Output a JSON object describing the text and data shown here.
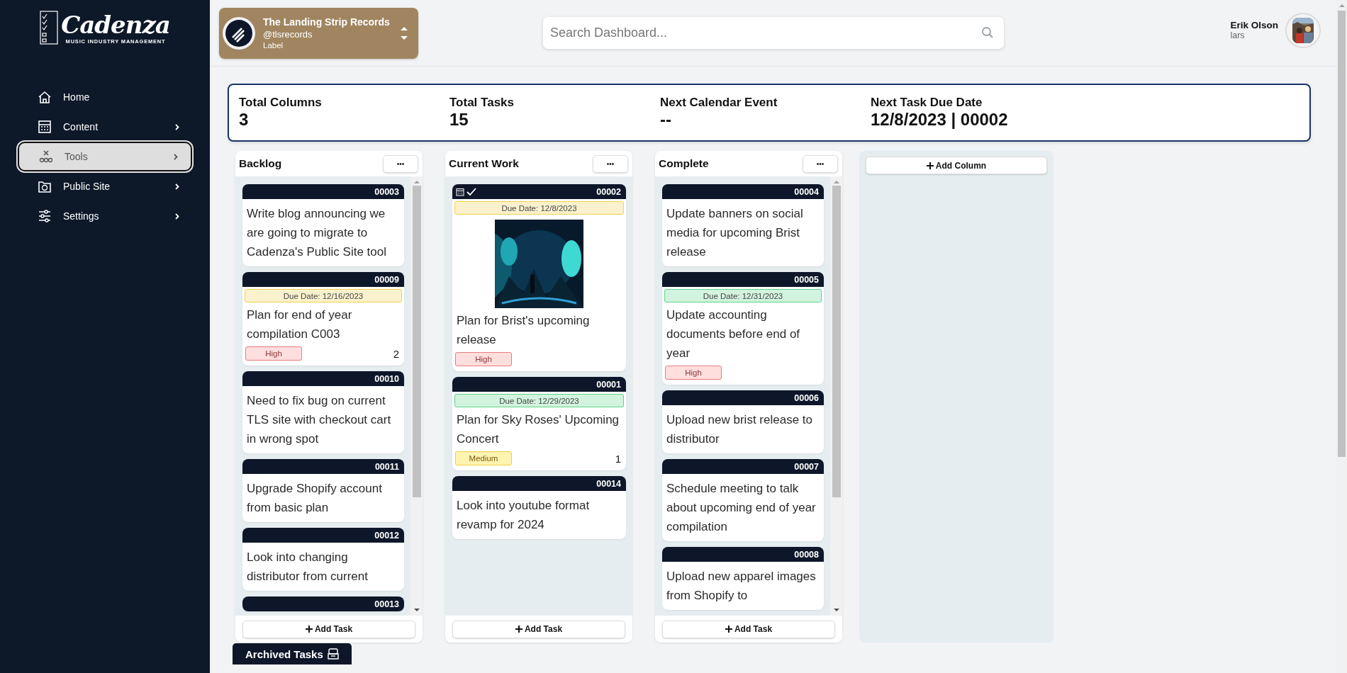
{
  "logo": {
    "name": "Cadenza",
    "tagline": "MUSIC INDUSTRY MANAGEMENT"
  },
  "sidebar": {
    "items": [
      {
        "label": "Home",
        "expandable": false,
        "selected": false
      },
      {
        "label": "Content",
        "expandable": true,
        "selected": false
      },
      {
        "label": "Tools",
        "expandable": true,
        "selected": true
      },
      {
        "label": "Public Site",
        "expandable": true,
        "selected": false
      },
      {
        "label": "Settings",
        "expandable": true,
        "selected": false
      }
    ]
  },
  "account_switcher": {
    "name": "The Landing Strip Records",
    "handle": "@tlsrecords",
    "type": "Label"
  },
  "search": {
    "placeholder": "Search Dashboard..."
  },
  "user": {
    "name": "Erik Olson",
    "username": "lars"
  },
  "stats": [
    {
      "label": "Total Columns",
      "value": "3"
    },
    {
      "label": "Total Tasks",
      "value": "15"
    },
    {
      "label": "Next Calendar Event",
      "value": "--"
    },
    {
      "label": "Next Task Due Date",
      "value": "12/8/2023 | 00002"
    }
  ],
  "columns": [
    {
      "title": "Backlog",
      "menu": "•••",
      "scrollbar": true,
      "add_label": "Add Task",
      "tasks": [
        {
          "id": "00003",
          "checked": false,
          "title": "Write blog announcing we are going to migrate to Cadenza's Public Site tool"
        },
        {
          "id": "00009",
          "checked": false,
          "due": {
            "text": "Due Date: 12/16/2023",
            "color": "#f2d04b"
          },
          "title": "Plan for end of year compilation C003",
          "priority": {
            "kind": "high",
            "label": "High"
          },
          "count": "2"
        },
        {
          "id": "00010",
          "checked": false,
          "title": "Need to fix bug on current TLS site with checkout cart in wrong spot"
        },
        {
          "id": "00011",
          "checked": false,
          "title": "Upgrade Shopify account from basic plan"
        },
        {
          "id": "00012",
          "checked": false,
          "title": "Look into changing distributor from current"
        },
        {
          "id": "00013",
          "checked": false
        }
      ]
    },
    {
      "title": "Current Work",
      "menu": "•••",
      "scrollbar": false,
      "add_label": "Add Task",
      "tasks": [
        {
          "id": "00002",
          "checked": true,
          "due": {
            "text": "Due Date: 12/8/2023",
            "color": "#f2d04b"
          },
          "title": "Plan for Brist's upcoming release",
          "priority": {
            "kind": "high",
            "label": "High"
          }
        },
        {
          "id": "00001",
          "checked": false,
          "due": {
            "text": "Due Date: 12/29/2023",
            "color": "#5fd38a"
          },
          "title": "Plan for Sky Roses' Upcoming Concert",
          "priority": {
            "kind": "medium",
            "label": "Medium"
          },
          "count": "1"
        },
        {
          "id": "00014",
          "checked": false,
          "title": "Look into youtube format revamp for 2024"
        }
      ]
    },
    {
      "title": "Complete",
      "menu": "•••",
      "scrollbar": true,
      "add_label": "Add Task",
      "tasks": [
        {
          "id": "00004",
          "checked": false,
          "title": "Update banners on social media for upcoming Brist release"
        },
        {
          "id": "00005",
          "checked": false,
          "due": {
            "text": "Due Date: 12/31/2023",
            "color": "#5fd38a"
          },
          "title": "Update accounting documents before end of year",
          "priority": {
            "kind": "high",
            "label": "High"
          }
        },
        {
          "id": "00006",
          "checked": false,
          "title": "Upload new brist release to distributor"
        },
        {
          "id": "00007",
          "checked": false,
          "title": "Schedule meeting to talk about upcoming end of year compilation"
        },
        {
          "id": "00008",
          "checked": false,
          "title": "Upload new apparel images from Shopify to"
        }
      ]
    }
  ],
  "add_column": {
    "label": "Add Column"
  },
  "archived": {
    "label": "Archived Tasks"
  }
}
